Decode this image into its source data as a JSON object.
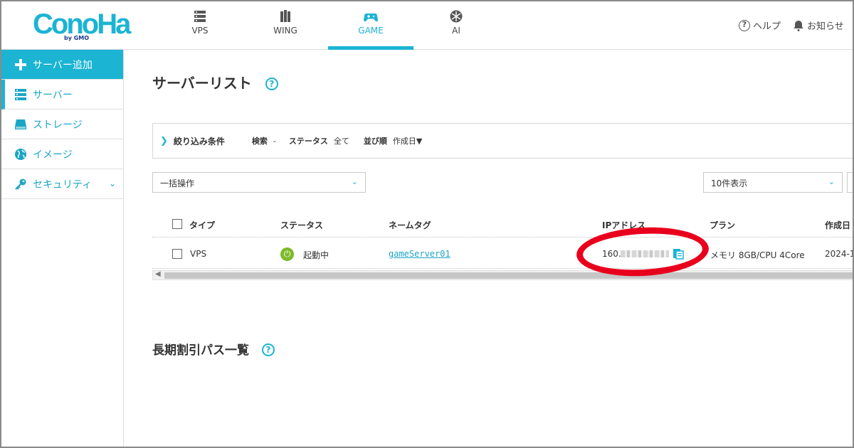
{
  "header": {
    "logo_text": "ConoHa",
    "logo_by": "by GMO",
    "tabs": [
      {
        "label": "VPS",
        "icon": "server-icon"
      },
      {
        "label": "WING",
        "icon": "wing-icon"
      },
      {
        "label": "GAME",
        "icon": "gamepad-icon",
        "active": true
      },
      {
        "label": "AI",
        "icon": "ai-icon"
      }
    ],
    "help_label": "ヘルプ",
    "notice_label": "お知らせ"
  },
  "sidebar": {
    "items": [
      {
        "label": "サーバー追加",
        "icon": "plus-icon"
      },
      {
        "label": "サーバー",
        "icon": "server-list-icon"
      },
      {
        "label": "ストレージ",
        "icon": "storage-icon"
      },
      {
        "label": "イメージ",
        "icon": "globe-icon"
      },
      {
        "label": "セキュリティ",
        "icon": "key-icon"
      }
    ]
  },
  "main": {
    "title": "サーバーリスト",
    "filter": {
      "label": "絞り込み条件",
      "search_label": "検索",
      "search_value": "-",
      "status_label": "ステータス",
      "status_value": "全て",
      "sort_label": "並び順",
      "sort_value": "作成日▼"
    },
    "bulk_action": "一括操作",
    "per_page": "10件表示",
    "table": {
      "headers": [
        "タイプ",
        "ステータス",
        "ネームタグ",
        "IPアドレス",
        "プラン",
        "作成日"
      ],
      "rows": [
        {
          "type": "VPS",
          "status": "起動中",
          "name_tag": "gameServer01",
          "ip_prefix": "160.",
          "plan": "メモリ 8GB/CPU 4Core",
          "created": "2024-1"
        }
      ]
    },
    "section2_title": "長期割引パス一覧"
  },
  "colors": {
    "accent": "#1bb4d3",
    "status_running": "#7cba2a",
    "annotation": "#e8001c"
  }
}
